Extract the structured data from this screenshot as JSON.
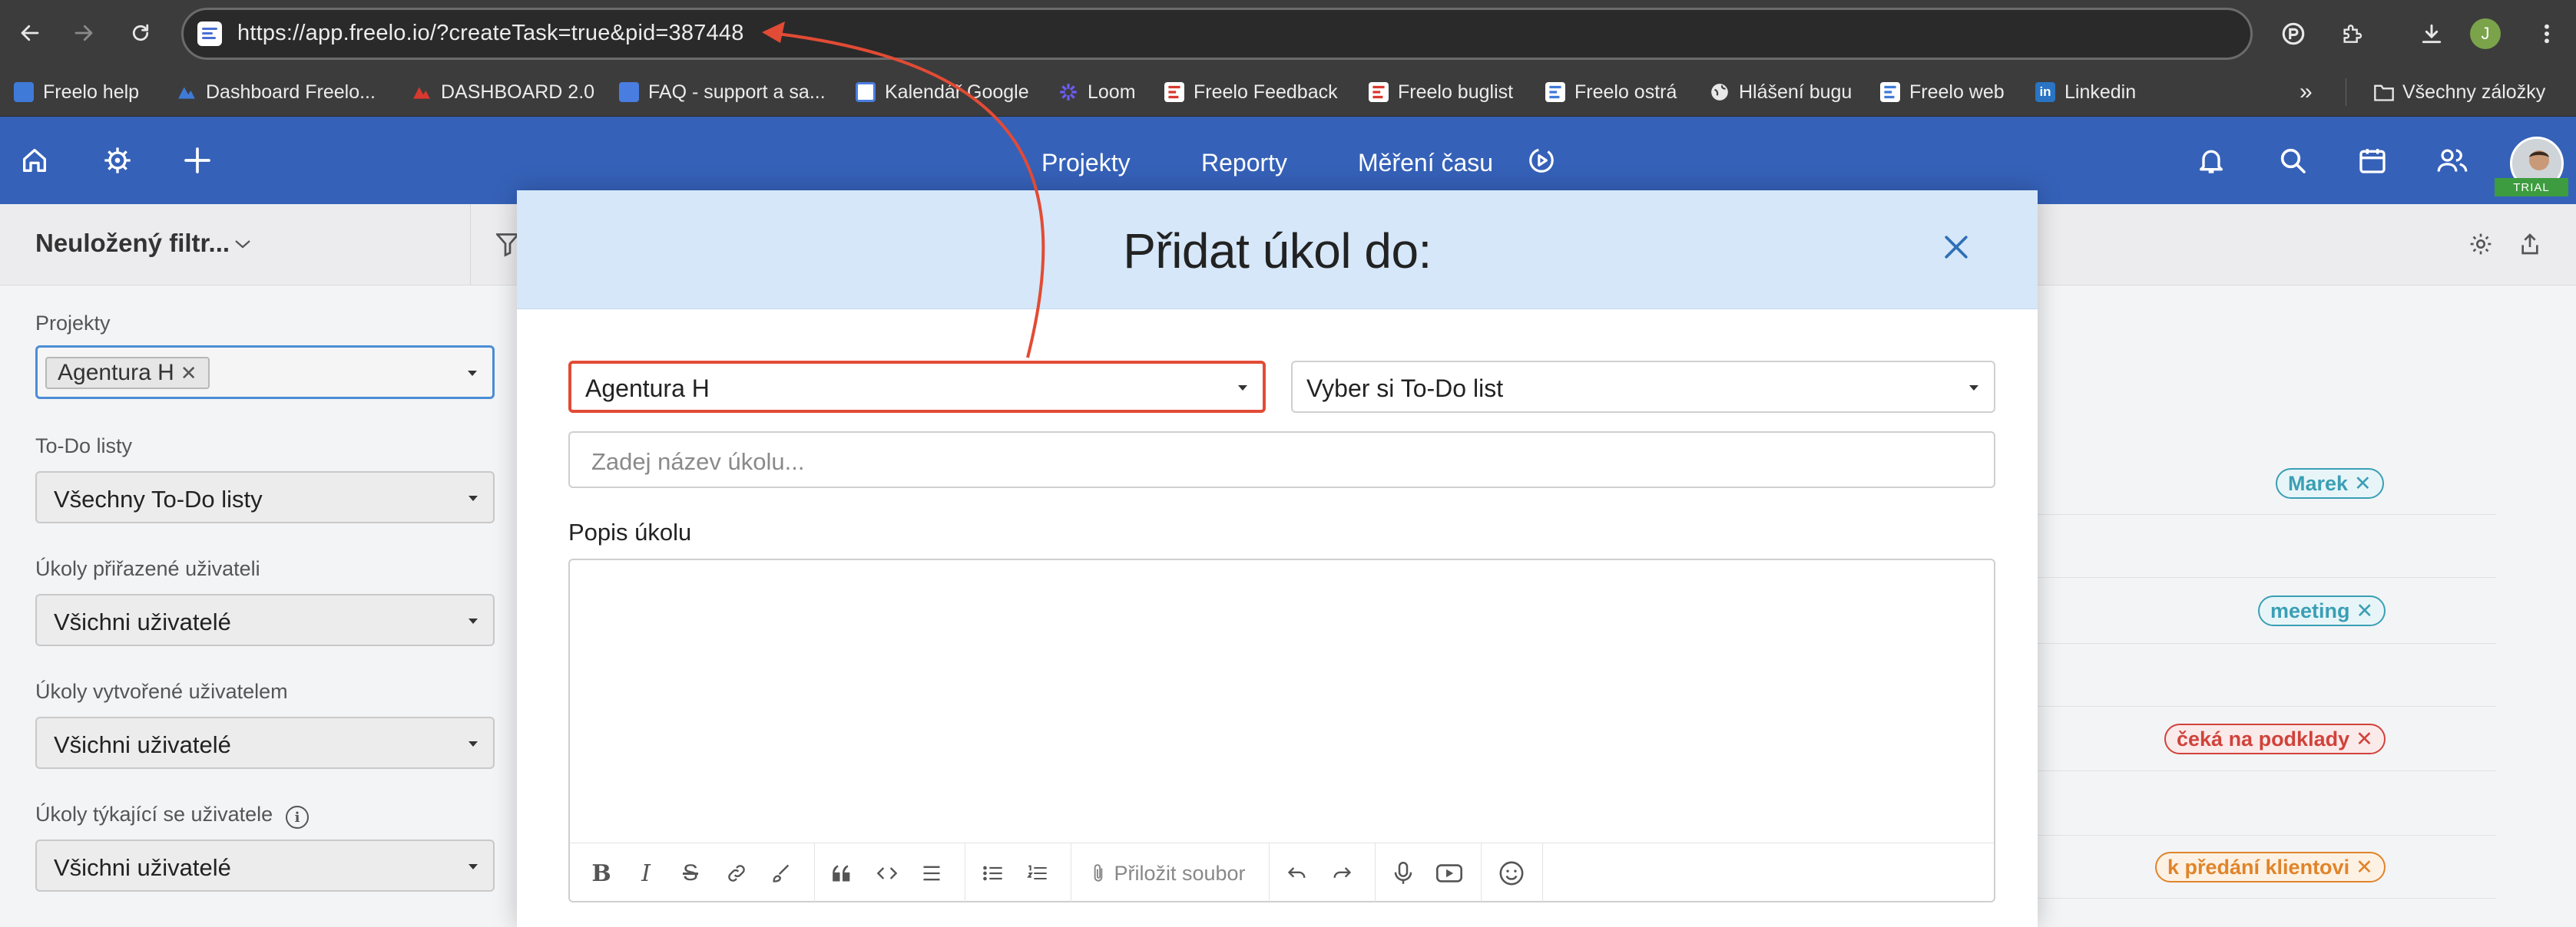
{
  "browser": {
    "url": "https://app.freelo.io/?createTask=true&pid=387448",
    "profile_initial": "J",
    "bookmarks": [
      {
        "label": "Freelo help",
        "icon": "freelo-icon"
      },
      {
        "label": "Dashboard Freelo...",
        "icon": "dashboard-icon"
      },
      {
        "label": "DASHBOARD 2.0",
        "icon": "dashboard-icon"
      },
      {
        "label": "FAQ - support a sa...",
        "icon": "docs-icon"
      },
      {
        "label": "Kalendář Google",
        "icon": "calendar-icon"
      },
      {
        "label": "Loom",
        "icon": "loom-icon"
      },
      {
        "label": "Freelo Feedback",
        "icon": "freelo-icon"
      },
      {
        "label": "Freelo buglist",
        "icon": "freelo-icon"
      },
      {
        "label": "Freelo ostrá",
        "icon": "freelo-icon"
      },
      {
        "label": "Hlášení bugu",
        "icon": "globe-icon"
      },
      {
        "label": "Freelo web",
        "icon": "freelo-icon"
      },
      {
        "label": "Linkedin",
        "icon": "linkedin-icon"
      }
    ],
    "all_bookmarks": "Všechny záložky",
    "more": "»"
  },
  "app_header": {
    "nav": [
      "Projekty",
      "Reporty",
      "Měření času"
    ],
    "trial": "TRIAL"
  },
  "sidebar": {
    "filter_title": "Neuložený filtr...",
    "projects_label": "Projekty",
    "projects_tag": "Agentura H",
    "todo_label": "To-Do listy",
    "todo_value": "Všechny To-Do listy",
    "assigned_label": "Úkoly přiřazené uživateli",
    "assigned_value": "Všichni uživatelé",
    "created_label": "Úkoly vytvořené uživatelem",
    "created_value": "Všichni uživatelé",
    "concerning_label": "Úkoly týkající se uživatele",
    "concerning_value": "Všichni uživatelé"
  },
  "task_labels": [
    {
      "text": "Marek",
      "color": "#3a9fb5"
    },
    {
      "text": "meeting",
      "color": "#3a9fb5"
    },
    {
      "text": "čeká na podklady",
      "color": "#d0433b"
    },
    {
      "text": "k předání klientovi",
      "color": "#e0842a"
    }
  ],
  "modal": {
    "title": "Přidat úkol do:",
    "project_value": "Agentura H",
    "todolist_placeholder": "Vyber si To-Do list",
    "task_name_placeholder": "Zadej název úkolu...",
    "description_label": "Popis úkolu",
    "attach_label": "Přiložit soubor"
  },
  "colors": {
    "header_blue": "#3561b8",
    "modal_header": "#d5e7f8",
    "highlight_red": "#e24b35"
  }
}
